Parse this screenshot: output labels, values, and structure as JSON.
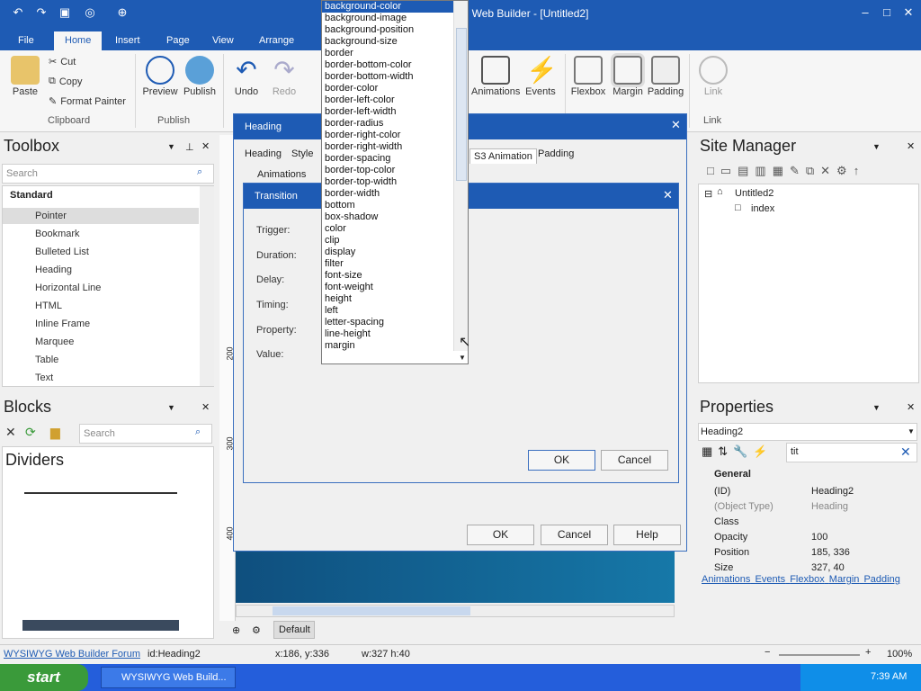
{
  "app": {
    "title": "Web Builder - [Untitled2]"
  },
  "tabs": [
    "File",
    "Home",
    "Insert",
    "Page",
    "View",
    "Arrange"
  ],
  "ribbon": {
    "paste": "Paste",
    "cut": "Cut",
    "copy": "Copy",
    "format_painter": "Format Painter",
    "clipboard": "Clipboard",
    "preview": "Preview",
    "publish": "Publish",
    "publish_group": "Publish",
    "undo": "Undo",
    "redo": "Redo",
    "animations": "Animations",
    "events": "Events",
    "flexbox": "Flexbox",
    "margin": "Margin",
    "padding": "Padding",
    "link": "Link",
    "link_group": "Link"
  },
  "toolbox": {
    "title": "Toolbox",
    "search_placeholder": "Search",
    "section": "Standard",
    "items": [
      "Pointer",
      "Bookmark",
      "Bulleted List",
      "Heading",
      "Horizontal Line",
      "HTML",
      "Inline Frame",
      "Marquee",
      "Table",
      "Text"
    ]
  },
  "blocks": {
    "title": "Blocks",
    "search_placeholder": "Search",
    "section": "Dividers"
  },
  "heading_dialog": {
    "title": "Heading",
    "tabs": [
      "Heading",
      "Style",
      "S3 Animation",
      "Padding"
    ],
    "animations_label": "Animations",
    "ok": "OK",
    "cancel": "Cancel",
    "help": "Help"
  },
  "transition_dialog": {
    "title": "Transition",
    "labels": [
      "Trigger:",
      "Duration:",
      "Delay:",
      "Timing:",
      "Property:",
      "Value:"
    ],
    "ok": "OK",
    "cancel": "Cancel"
  },
  "dropdown": {
    "items": [
      "background-color",
      "background-image",
      "background-position",
      "background-size",
      "border",
      "border-bottom-color",
      "border-bottom-width",
      "border-color",
      "border-left-color",
      "border-left-width",
      "border-radius",
      "border-right-color",
      "border-right-width",
      "border-spacing",
      "border-top-color",
      "border-top-width",
      "border-width",
      "bottom",
      "box-shadow",
      "color",
      "clip",
      "display",
      "filter",
      "font-size",
      "font-weight",
      "height",
      "left",
      "letter-spacing",
      "line-height",
      "margin"
    ]
  },
  "ruler": [
    "200",
    "300",
    "400"
  ],
  "site_manager": {
    "title": "Site Manager",
    "root": "Untitled2",
    "page": "index"
  },
  "properties": {
    "title": "Properties",
    "selector": "Heading2",
    "search": "tit",
    "section": "General",
    "rows": [
      {
        "k": "(ID)",
        "v": "Heading2"
      },
      {
        "k": "(Object Type)",
        "v": "Heading"
      },
      {
        "k": "Class",
        "v": ""
      },
      {
        "k": "Opacity",
        "v": "100"
      },
      {
        "k": "Position",
        "v": "185, 336"
      },
      {
        "k": "Size",
        "v": "327, 40"
      }
    ],
    "links": [
      "Animations",
      "Events",
      "Flexbox",
      "Margin",
      "Padding"
    ]
  },
  "canvas": {
    "default_tab": "Default"
  },
  "status": {
    "forum": "WYSIWYG Web Builder Forum",
    "id": "id:Heading2",
    "xy": "x:186, y:336",
    "wh": "w:327 h:40",
    "zoom": "100%"
  },
  "taskbar": {
    "start": "start",
    "task": "WYSIWYG Web Build...",
    "time": "7:39 AM"
  }
}
